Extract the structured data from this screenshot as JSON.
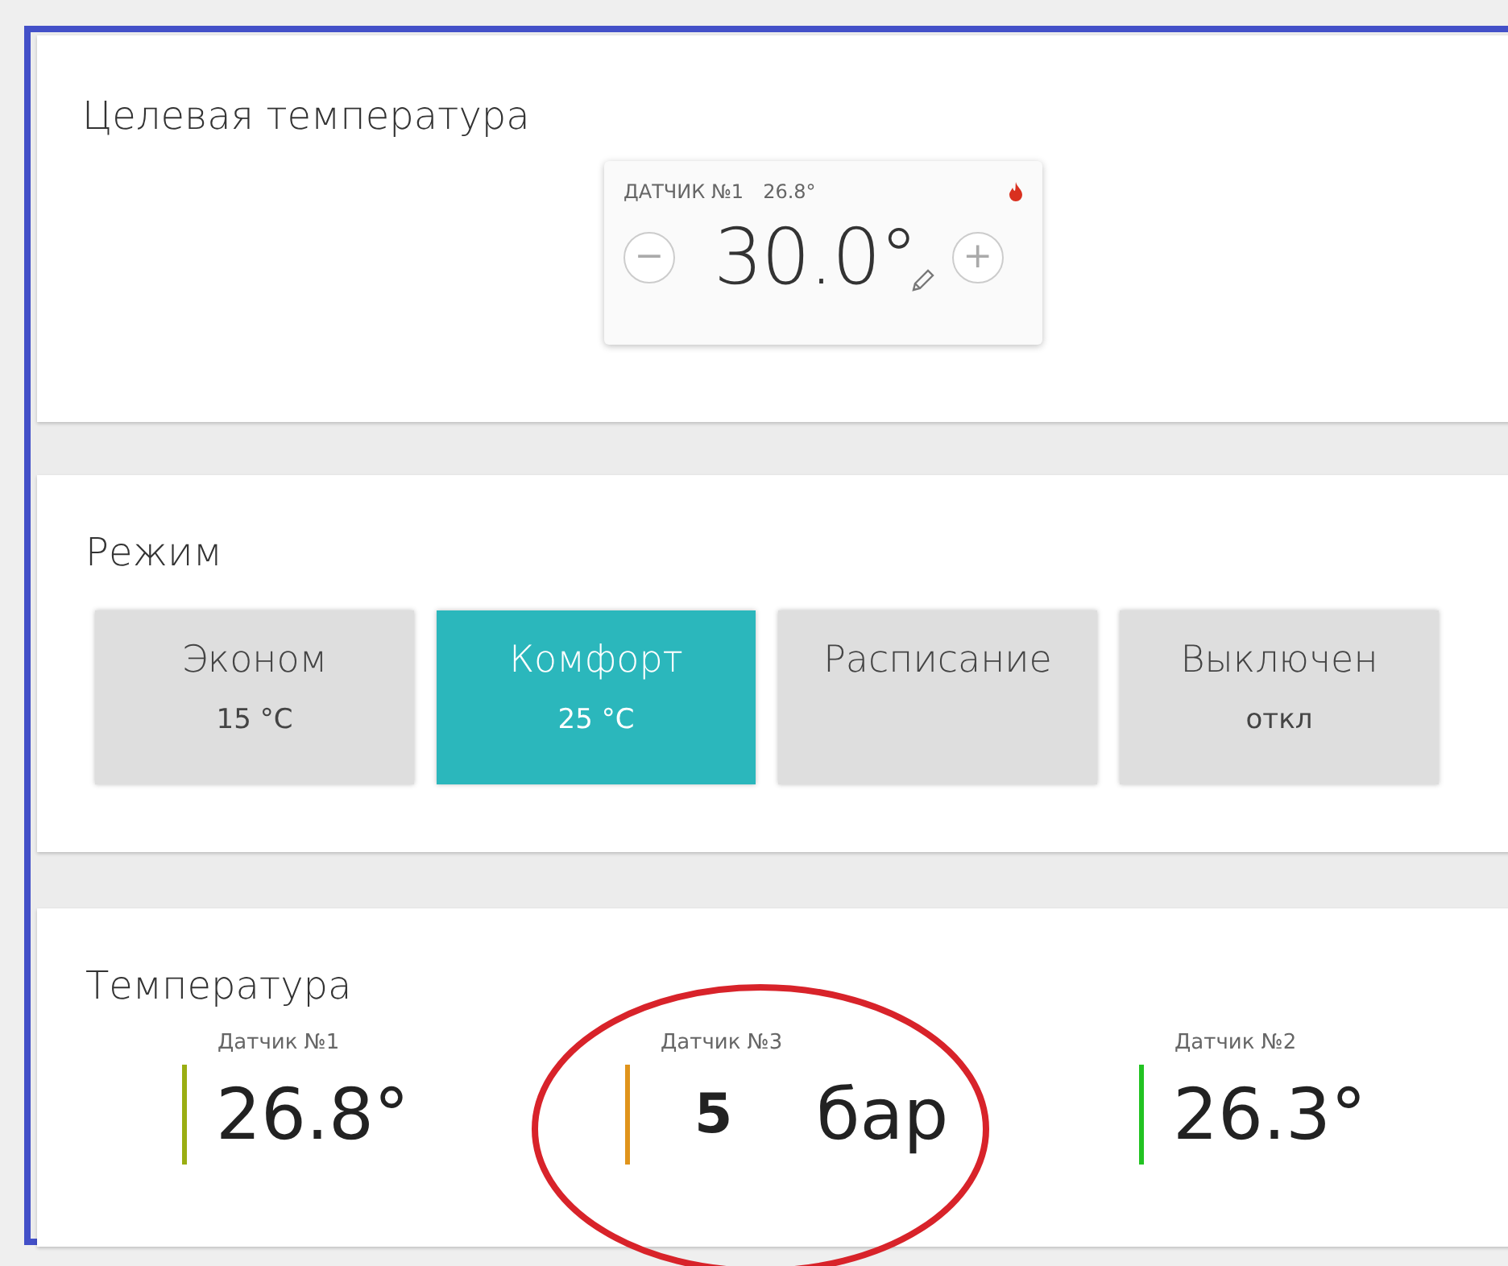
{
  "target": {
    "title": "Целевая температура",
    "sensor_label": "ДАТЧИК №1",
    "sensor_value": "26.8°",
    "heating": true,
    "setpoint": "30.0°",
    "minus": "−",
    "plus": "+"
  },
  "mode": {
    "title": "Режим",
    "options": [
      {
        "label": "Эконом",
        "sub": "15 °C",
        "selected": false
      },
      {
        "label": "Комфорт",
        "sub": "25 °C",
        "selected": true
      },
      {
        "label": "Расписание",
        "selected": false
      },
      {
        "label": "Выключен",
        "sub": "откл",
        "selected": false
      }
    ]
  },
  "temperature": {
    "title": "Температура",
    "sensors": [
      {
        "name": "Датчик №1",
        "value": "26.8°",
        "color": "#9aae12",
        "bold": false
      },
      {
        "name": "Датчик №3",
        "value": "5",
        "unit": "бар",
        "color": "#e0941c",
        "bold": true
      },
      {
        "name": "Датчик №2",
        "value": "26.3°",
        "color": "#22c322",
        "bold": false
      }
    ]
  },
  "annotation": {
    "kind": "ellipse"
  }
}
